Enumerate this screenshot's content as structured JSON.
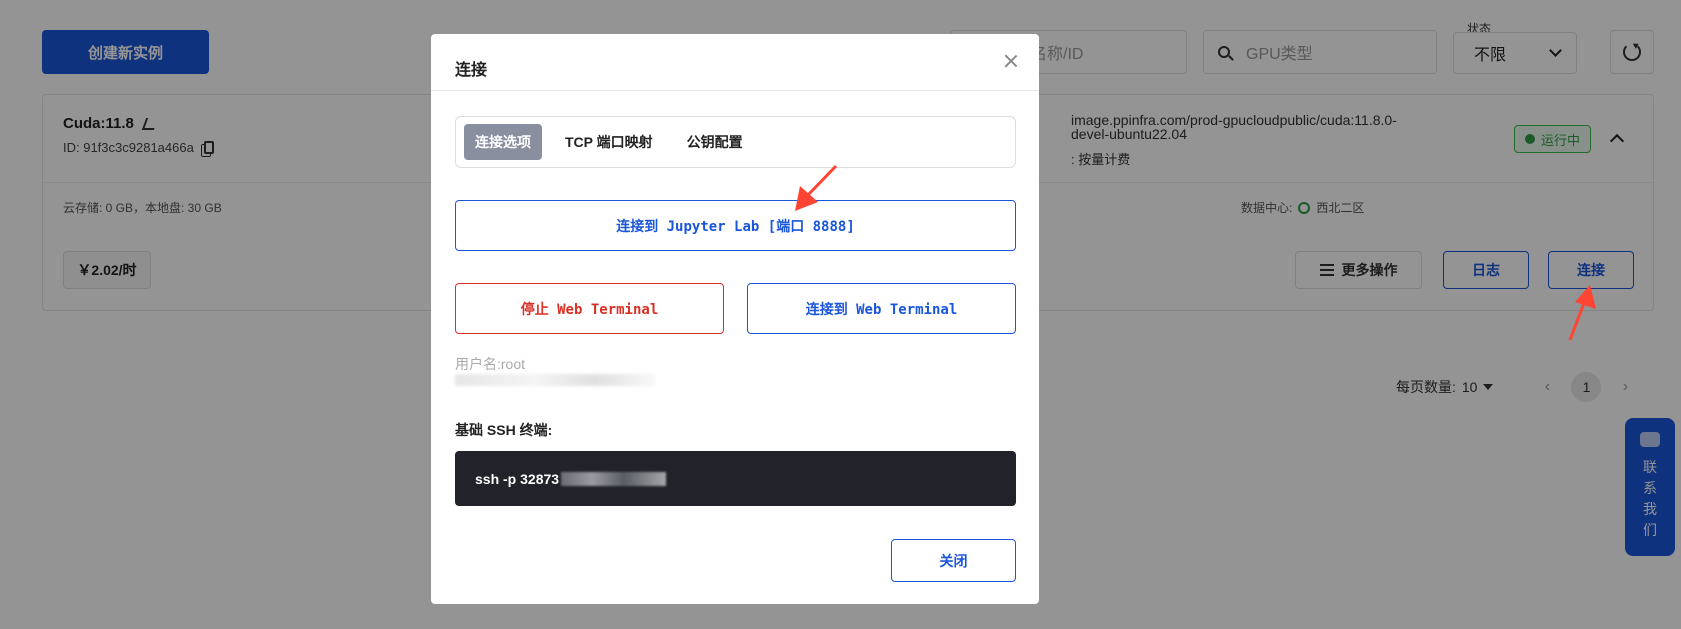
{
  "toolbar": {
    "create_label": "创建新实例",
    "name_search_placeholder": "名称/ID",
    "gpu_search_placeholder": "GPU类型",
    "status_label": "状态",
    "status_value": "不限"
  },
  "instance": {
    "name": "Cuda:11.8",
    "id": "ID: 91f3c3c9281a466a",
    "image_line1": "image.ppinfra.com/prod-gpucloudpublic/cuda:11.8.0-",
    "image_line2": "devel-ubuntu22.04",
    "billing": ": 按量计费",
    "status": "运行中",
    "storage": "云存储: 0 GB，本地盘: 30 GB",
    "datacenter_label": "数据中心:",
    "datacenter_value": "西北二区",
    "price": "￥2.02/时",
    "more_label": "更多操作",
    "log_label": "日志",
    "connect_label": "连接"
  },
  "pagination": {
    "page_size_label": "每页数量:",
    "page_size": "10",
    "prev": "‹",
    "current": "1",
    "next": "›"
  },
  "contact": {
    "label": "联系我们",
    "chars": [
      "联",
      "系",
      "我",
      "们"
    ]
  },
  "modal": {
    "title": "连接",
    "tabs": [
      {
        "label": "连接选项",
        "active": true
      },
      {
        "label": "TCP 端口映射",
        "active": false
      },
      {
        "label": "公钥配置",
        "active": false
      }
    ],
    "jupyter_label": "连接到 Jupyter Lab [端口 8888]",
    "stop_terminal_label": "停止 Web Terminal",
    "connect_terminal_label": "连接到 Web Terminal",
    "username": "用户名:root",
    "ssh_label": "基础 SSH 终端:",
    "ssh_command": "ssh -p 32873",
    "close_label": "关闭"
  },
  "colors": {
    "primary": "#1a56db",
    "danger": "#d93025",
    "success": "#2e9c45",
    "annotation_arrow": "#ff4433",
    "terminal_bg": "#22232a"
  }
}
